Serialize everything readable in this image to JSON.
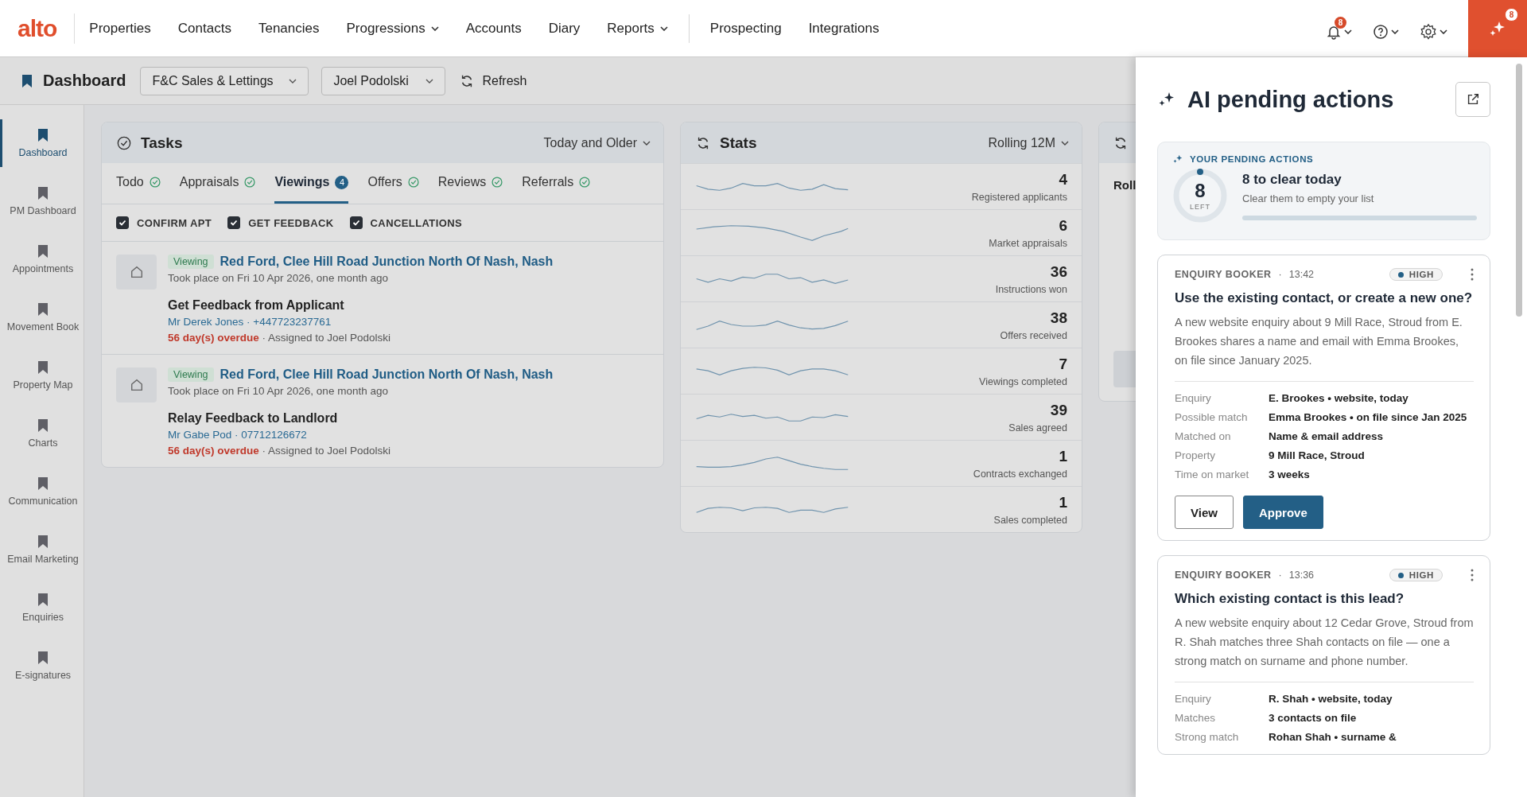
{
  "topnav": {
    "logo": "alto",
    "items": [
      {
        "label": "Properties",
        "dropdown": false,
        "divider_before": false
      },
      {
        "label": "Contacts",
        "dropdown": false,
        "divider_before": false
      },
      {
        "label": "Tenancies",
        "dropdown": false,
        "divider_before": false
      },
      {
        "label": "Progressions",
        "dropdown": true,
        "divider_before": false
      },
      {
        "label": "Accounts",
        "dropdown": false,
        "divider_before": false
      },
      {
        "label": "Diary",
        "dropdown": false,
        "divider_before": false
      },
      {
        "label": "Reports",
        "dropdown": true,
        "divider_before": false
      },
      {
        "label": "Prospecting",
        "dropdown": false,
        "divider_before": true
      },
      {
        "label": "Integrations",
        "dropdown": false,
        "divider_before": false
      }
    ],
    "notifications_badge": "8",
    "ai_badge": "8"
  },
  "subheader": {
    "title": "Dashboard",
    "branch": "F&C Sales & Lettings",
    "user": "Joel Podolski",
    "refresh": "Refresh"
  },
  "sidebar": {
    "items": [
      {
        "label": "Dashboard",
        "selected": true
      },
      {
        "label": "PM Dashboard",
        "selected": false
      },
      {
        "label": "Appointments",
        "selected": false
      },
      {
        "label": "Movement Book",
        "selected": false
      },
      {
        "label": "Property Map",
        "selected": false
      },
      {
        "label": "Charts",
        "selected": false
      },
      {
        "label": "Communication",
        "selected": false
      },
      {
        "label": "Email Marketing",
        "selected": false
      },
      {
        "label": "Enquiries",
        "selected": false
      },
      {
        "label": "E-signatures",
        "selected": false
      }
    ]
  },
  "tasks": {
    "title": "Tasks",
    "filter": "Today and Older",
    "tabs": [
      {
        "label": "Todo",
        "selected": false,
        "done": true
      },
      {
        "label": "Appraisals",
        "selected": false,
        "done": true
      },
      {
        "label": "Viewings",
        "selected": true,
        "done": false,
        "count": "4"
      },
      {
        "label": "Offers",
        "selected": false,
        "done": true
      },
      {
        "label": "Reviews",
        "selected": false,
        "done": true
      },
      {
        "label": "Referrals",
        "selected": false,
        "done": true
      }
    ],
    "filters": [
      {
        "label": "CONFIRM APT",
        "checked": true
      },
      {
        "label": "GET FEEDBACK",
        "checked": true
      },
      {
        "label": "CANCELLATIONS",
        "checked": true
      }
    ],
    "items": [
      {
        "tag": "Viewing",
        "address": "Red Ford, Clee Hill Road Junction North Of Nash, Nash",
        "when": "Took place on Fri 10 Apr 2026, one month ago",
        "task": "Get Feedback from Applicant",
        "contact": "Mr Derek Jones · +447723237761",
        "overdue": "56 day(s) overdue",
        "assigned": "· Assigned to Joel Podolski"
      },
      {
        "tag": "Viewing",
        "address": "Red Ford, Clee Hill Road Junction North Of Nash, Nash",
        "when": "Took place on Fri 10 Apr 2026, one month ago",
        "task": "Relay Feedback to Landlord",
        "contact": "Mr Gabe Pod · 07712126672",
        "overdue": "56 day(s) overdue",
        "assigned": "· Assigned to Joel Podolski"
      }
    ]
  },
  "stats": {
    "title": "Stats",
    "period": "Rolling 12M",
    "rows": [
      {
        "value": "4",
        "label": "Registered applicants"
      },
      {
        "value": "6",
        "label": "Market appraisals"
      },
      {
        "value": "36",
        "label": "Instructions won"
      },
      {
        "value": "38",
        "label": "Offers received"
      },
      {
        "value": "7",
        "label": "Viewings completed"
      },
      {
        "value": "39",
        "label": "Sales agreed"
      },
      {
        "value": "1",
        "label": "Contracts exchanged"
      },
      {
        "value": "1",
        "label": "Sales completed"
      }
    ]
  },
  "third_card": {
    "text": "Roll"
  },
  "ai_panel": {
    "title": "AI pending actions",
    "summary": {
      "heading": "YOUR PENDING ACTIONS",
      "count": "8",
      "count_caption": "LEFT",
      "title": "8 to clear today",
      "subtitle": "Clear them to empty your list",
      "level": 0
    },
    "cards": [
      {
        "source": "ENQUIRY BOOKER",
        "separator": "·",
        "time": "13:42",
        "priority": "HIGH",
        "color": "#235f86",
        "title": "Use the existing contact, or create a new one?",
        "description": "A new website enquiry about 9 Mill Race, Stroud from E. Brookes shares a name and email with Emma Brookes, on file since January 2025.",
        "details": [
          {
            "label": "Enquiry",
            "value": "E. Brookes • website, today"
          },
          {
            "label": "Possible match",
            "value": "Emma Brookes • on file since Jan 2025"
          },
          {
            "label": "Matched on",
            "value": "Name & email address"
          },
          {
            "label": "Property",
            "value": "9 Mill Race, Stroud"
          },
          {
            "label": "Time on market",
            "value": "3 weeks"
          }
        ],
        "buttons": [
          "View",
          "Approve"
        ]
      },
      {
        "source": "ENQUIRY BOOKER",
        "separator": "·",
        "time": "13:36",
        "priority": "HIGH",
        "color": "#235f86",
        "title": "Which existing contact is this lead?",
        "description": "A new website enquiry about 12 Cedar Grove, Stroud from R. Shah matches three Shah contacts on file — one a strong match on surname and phone number.",
        "details": [
          {
            "label": "Enquiry",
            "value": "R. Shah • website, today"
          },
          {
            "label": "Matches",
            "value": "3 contacts on file"
          },
          {
            "label": "Strong match",
            "value": "Rohan Shah • surname &"
          }
        ]
      }
    ]
  }
}
